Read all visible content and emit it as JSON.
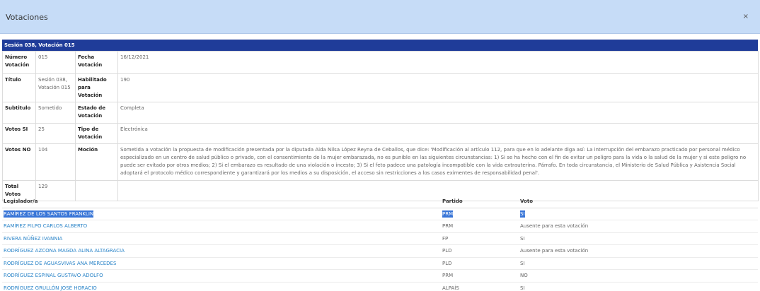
{
  "modal": {
    "title": "Votaciones",
    "close_glyph": "×"
  },
  "session_header": "Sesión 038, Votación 015",
  "info": {
    "numero_label": "Número Votación",
    "numero_value": "015",
    "fecha_label": "Fecha Votación",
    "fecha_value": "16/12/2021",
    "titulo_label": "Título",
    "titulo_value": "Sesión 038, Votación 015",
    "habilitado_label": "Habilitado para Votación",
    "habilitado_value": "190",
    "subtitulo_label": "Subtitulo",
    "subtitulo_value": "Sometido",
    "estado_label": "Estado de Votación",
    "estado_value": "Completa",
    "si_label": "Votos SI",
    "si_value": "25",
    "tipo_label": "Tipo de Votación",
    "tipo_value": "Electrónica",
    "no_label": "Votos NO",
    "no_value": "104",
    "mocion_label": "Moción",
    "mocion_value": "Sometida a votación la propuesta de modificación presentada por la diputada Aida Nilsa López Reyna de Ceballos, que dice: 'Modificación al artículo 112, para que en lo adelante diga así: La interrupción del embarazo practicado por personal médico especializado en un centro de salud público o privado, con el consentimiento de la mujer embarazada, no es punible en las siguientes circunstancias: 1) Si se ha hecho con el fin de evitar un peligro para la vida o la salud de la mujer y si este peligro no puede ser evitado por otros medios; 2) Si el embarazo es resultado de una violación o incesto; 3) Si el feto padece una patología incompatible con la vida extrauterina. Párrafo. En toda circunstancia, el Ministerio de Salud Pública y Asistencia Social adoptará el protocolo médico correspondiente y garantizará por los medios a su disposición, el acceso sin restricciones a los casos eximentes de responsabilidad penal'.",
    "total_label": "Total Votos",
    "total_value": "129"
  },
  "votes_table": {
    "headers": {
      "legislator": "Legislador/a",
      "party": "Partido",
      "vote": "Voto"
    },
    "rows": [
      {
        "name": "RAMÍREZ DE LOS SANTOS FRANKLIN",
        "party": "PRM",
        "vote": "SI"
      },
      {
        "name": "RAMÍREZ FILPO CARLOS ALBERTO",
        "party": "PRM",
        "vote": "Ausente para esta votación"
      },
      {
        "name": "RIVERA NÚÑEZ IVANNIA",
        "party": "FP",
        "vote": "SI"
      },
      {
        "name": "RODRÍGUEZ AZCONA MAGDA ALINA ALTAGRACIA",
        "party": "PLD",
        "vote": "Ausente para esta votación"
      },
      {
        "name": "RODRÍGUEZ DE AGUASVIVAS ANA MERCEDES",
        "party": "PLD",
        "vote": "SI"
      },
      {
        "name": "RODRÍGUEZ ESPINAL GUSTAVO ADOLFO",
        "party": "PRM",
        "vote": "NO"
      },
      {
        "name": "RODRÍGUEZ GRULLÓN JOSÉ HORACIO",
        "party": "ALPAÍS",
        "vote": "SI"
      }
    ]
  }
}
